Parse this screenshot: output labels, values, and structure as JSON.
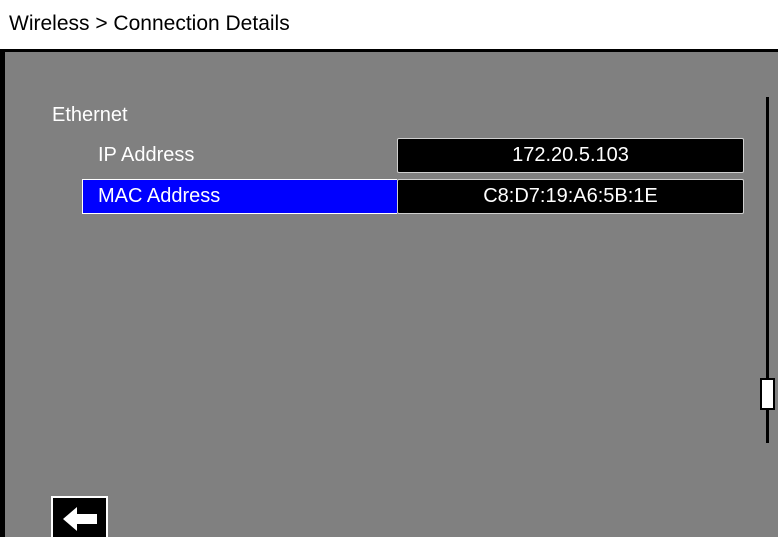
{
  "title": "Wireless > Connection Details",
  "section": {
    "label": "Ethernet",
    "fields": [
      {
        "label": "IP Address",
        "value": "172.20.5.103",
        "selected": false
      },
      {
        "label": "MAC Address",
        "value": "C8:D7:19:A6:5B:1E",
        "selected": true
      }
    ]
  },
  "scrollbar": {
    "position": "lower",
    "visible": true
  },
  "back_button": {
    "icon": "left-arrow-icon"
  },
  "colors": {
    "background": "#808080",
    "title_bar": "#ffffff",
    "selection": "#0000ff",
    "value_box": "#000000",
    "text": "#ffffff"
  }
}
